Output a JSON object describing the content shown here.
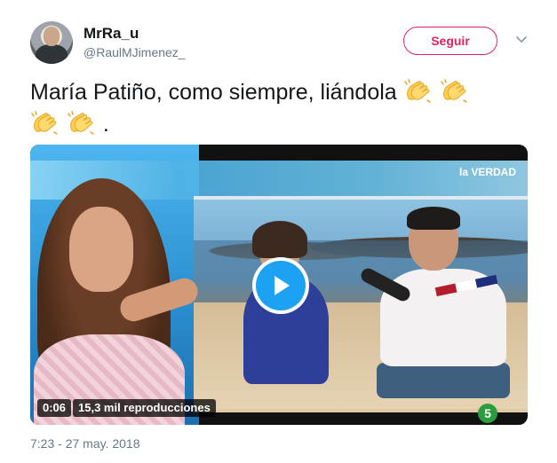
{
  "user": {
    "display_name": "MrRa_u",
    "handle": "@RaulMJimenez_"
  },
  "follow_button": {
    "label": "Seguir",
    "color": "#e0245e"
  },
  "tweet": {
    "text": "María Patiño, como siempre, liándola",
    "emoji": "clapping-hands",
    "emoji_count": 4,
    "trailing_punct": "."
  },
  "video": {
    "duration": "0:06",
    "views": "15,3 mil reproducciones",
    "play_icon": "play-icon",
    "play_color": "#1da1f2",
    "on_screen_logo": "la VERDAD",
    "channel_number": "5"
  },
  "meta": {
    "timestamp": "7:23 - 27 may. 2018"
  },
  "colors": {
    "text": "#14171a",
    "muted": "#657786"
  }
}
